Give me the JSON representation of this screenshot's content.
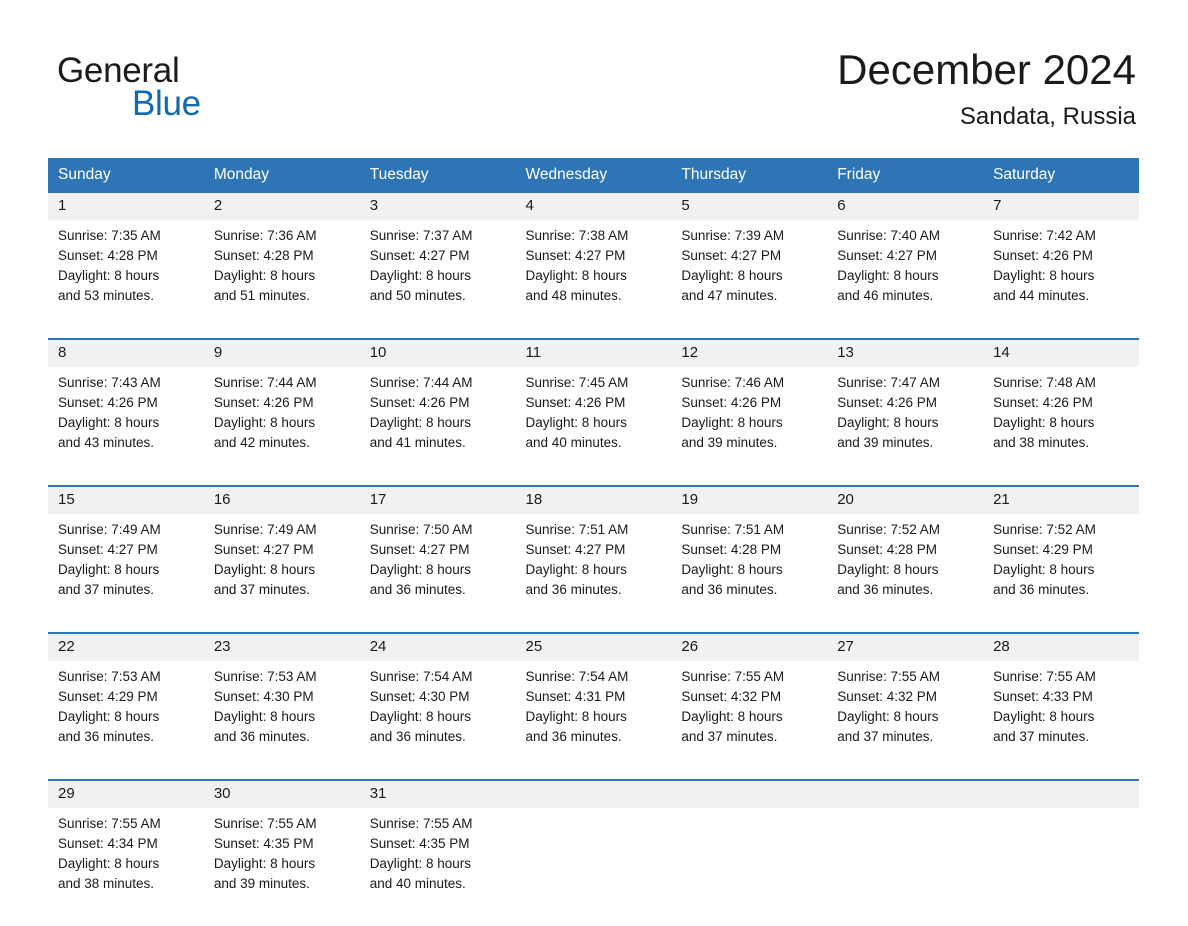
{
  "brand": {
    "name_dark": "General",
    "name_blue": "Blue",
    "accent_color": "#1169b0"
  },
  "header": {
    "title": "December 2024",
    "subtitle": "Sandata, Russia",
    "header_bg_color": "#2e75b6",
    "header_text_color": "#ffffff",
    "daynum_bg_color": "#f1f1f1",
    "rule_color": "#2e75b6"
  },
  "weekdays": [
    "Sunday",
    "Monday",
    "Tuesday",
    "Wednesday",
    "Thursday",
    "Friday",
    "Saturday"
  ],
  "weeks": [
    {
      "days": [
        {
          "num": "1",
          "sunrise": "Sunrise: 7:35 AM",
          "sunset": "Sunset: 4:28 PM",
          "daylight1": "Daylight: 8 hours",
          "daylight2": "and 53 minutes."
        },
        {
          "num": "2",
          "sunrise": "Sunrise: 7:36 AM",
          "sunset": "Sunset: 4:28 PM",
          "daylight1": "Daylight: 8 hours",
          "daylight2": "and 51 minutes."
        },
        {
          "num": "3",
          "sunrise": "Sunrise: 7:37 AM",
          "sunset": "Sunset: 4:27 PM",
          "daylight1": "Daylight: 8 hours",
          "daylight2": "and 50 minutes."
        },
        {
          "num": "4",
          "sunrise": "Sunrise: 7:38 AM",
          "sunset": "Sunset: 4:27 PM",
          "daylight1": "Daylight: 8 hours",
          "daylight2": "and 48 minutes."
        },
        {
          "num": "5",
          "sunrise": "Sunrise: 7:39 AM",
          "sunset": "Sunset: 4:27 PM",
          "daylight1": "Daylight: 8 hours",
          "daylight2": "and 47 minutes."
        },
        {
          "num": "6",
          "sunrise": "Sunrise: 7:40 AM",
          "sunset": "Sunset: 4:27 PM",
          "daylight1": "Daylight: 8 hours",
          "daylight2": "and 46 minutes."
        },
        {
          "num": "7",
          "sunrise": "Sunrise: 7:42 AM",
          "sunset": "Sunset: 4:26 PM",
          "daylight1": "Daylight: 8 hours",
          "daylight2": "and 44 minutes."
        }
      ]
    },
    {
      "days": [
        {
          "num": "8",
          "sunrise": "Sunrise: 7:43 AM",
          "sunset": "Sunset: 4:26 PM",
          "daylight1": "Daylight: 8 hours",
          "daylight2": "and 43 minutes."
        },
        {
          "num": "9",
          "sunrise": "Sunrise: 7:44 AM",
          "sunset": "Sunset: 4:26 PM",
          "daylight1": "Daylight: 8 hours",
          "daylight2": "and 42 minutes."
        },
        {
          "num": "10",
          "sunrise": "Sunrise: 7:44 AM",
          "sunset": "Sunset: 4:26 PM",
          "daylight1": "Daylight: 8 hours",
          "daylight2": "and 41 minutes."
        },
        {
          "num": "11",
          "sunrise": "Sunrise: 7:45 AM",
          "sunset": "Sunset: 4:26 PM",
          "daylight1": "Daylight: 8 hours",
          "daylight2": "and 40 minutes."
        },
        {
          "num": "12",
          "sunrise": "Sunrise: 7:46 AM",
          "sunset": "Sunset: 4:26 PM",
          "daylight1": "Daylight: 8 hours",
          "daylight2": "and 39 minutes."
        },
        {
          "num": "13",
          "sunrise": "Sunrise: 7:47 AM",
          "sunset": "Sunset: 4:26 PM",
          "daylight1": "Daylight: 8 hours",
          "daylight2": "and 39 minutes."
        },
        {
          "num": "14",
          "sunrise": "Sunrise: 7:48 AM",
          "sunset": "Sunset: 4:26 PM",
          "daylight1": "Daylight: 8 hours",
          "daylight2": "and 38 minutes."
        }
      ]
    },
    {
      "days": [
        {
          "num": "15",
          "sunrise": "Sunrise: 7:49 AM",
          "sunset": "Sunset: 4:27 PM",
          "daylight1": "Daylight: 8 hours",
          "daylight2": "and 37 minutes."
        },
        {
          "num": "16",
          "sunrise": "Sunrise: 7:49 AM",
          "sunset": "Sunset: 4:27 PM",
          "daylight1": "Daylight: 8 hours",
          "daylight2": "and 37 minutes."
        },
        {
          "num": "17",
          "sunrise": "Sunrise: 7:50 AM",
          "sunset": "Sunset: 4:27 PM",
          "daylight1": "Daylight: 8 hours",
          "daylight2": "and 36 minutes."
        },
        {
          "num": "18",
          "sunrise": "Sunrise: 7:51 AM",
          "sunset": "Sunset: 4:27 PM",
          "daylight1": "Daylight: 8 hours",
          "daylight2": "and 36 minutes."
        },
        {
          "num": "19",
          "sunrise": "Sunrise: 7:51 AM",
          "sunset": "Sunset: 4:28 PM",
          "daylight1": "Daylight: 8 hours",
          "daylight2": "and 36 minutes."
        },
        {
          "num": "20",
          "sunrise": "Sunrise: 7:52 AM",
          "sunset": "Sunset: 4:28 PM",
          "daylight1": "Daylight: 8 hours",
          "daylight2": "and 36 minutes."
        },
        {
          "num": "21",
          "sunrise": "Sunrise: 7:52 AM",
          "sunset": "Sunset: 4:29 PM",
          "daylight1": "Daylight: 8 hours",
          "daylight2": "and 36 minutes."
        }
      ]
    },
    {
      "days": [
        {
          "num": "22",
          "sunrise": "Sunrise: 7:53 AM",
          "sunset": "Sunset: 4:29 PM",
          "daylight1": "Daylight: 8 hours",
          "daylight2": "and 36 minutes."
        },
        {
          "num": "23",
          "sunrise": "Sunrise: 7:53 AM",
          "sunset": "Sunset: 4:30 PM",
          "daylight1": "Daylight: 8 hours",
          "daylight2": "and 36 minutes."
        },
        {
          "num": "24",
          "sunrise": "Sunrise: 7:54 AM",
          "sunset": "Sunset: 4:30 PM",
          "daylight1": "Daylight: 8 hours",
          "daylight2": "and 36 minutes."
        },
        {
          "num": "25",
          "sunrise": "Sunrise: 7:54 AM",
          "sunset": "Sunset: 4:31 PM",
          "daylight1": "Daylight: 8 hours",
          "daylight2": "and 36 minutes."
        },
        {
          "num": "26",
          "sunrise": "Sunrise: 7:55 AM",
          "sunset": "Sunset: 4:32 PM",
          "daylight1": "Daylight: 8 hours",
          "daylight2": "and 37 minutes."
        },
        {
          "num": "27",
          "sunrise": "Sunrise: 7:55 AM",
          "sunset": "Sunset: 4:32 PM",
          "daylight1": "Daylight: 8 hours",
          "daylight2": "and 37 minutes."
        },
        {
          "num": "28",
          "sunrise": "Sunrise: 7:55 AM",
          "sunset": "Sunset: 4:33 PM",
          "daylight1": "Daylight: 8 hours",
          "daylight2": "and 37 minutes."
        }
      ]
    },
    {
      "days": [
        {
          "num": "29",
          "sunrise": "Sunrise: 7:55 AM",
          "sunset": "Sunset: 4:34 PM",
          "daylight1": "Daylight: 8 hours",
          "daylight2": "and 38 minutes."
        },
        {
          "num": "30",
          "sunrise": "Sunrise: 7:55 AM",
          "sunset": "Sunset: 4:35 PM",
          "daylight1": "Daylight: 8 hours",
          "daylight2": "and 39 minutes."
        },
        {
          "num": "31",
          "sunrise": "Sunrise: 7:55 AM",
          "sunset": "Sunset: 4:35 PM",
          "daylight1": "Daylight: 8 hours",
          "daylight2": "and 40 minutes."
        },
        {
          "num": "",
          "sunrise": "",
          "sunset": "",
          "daylight1": "",
          "daylight2": ""
        },
        {
          "num": "",
          "sunrise": "",
          "sunset": "",
          "daylight1": "",
          "daylight2": ""
        },
        {
          "num": "",
          "sunrise": "",
          "sunset": "",
          "daylight1": "",
          "daylight2": ""
        },
        {
          "num": "",
          "sunrise": "",
          "sunset": "",
          "daylight1": "",
          "daylight2": ""
        }
      ]
    }
  ]
}
